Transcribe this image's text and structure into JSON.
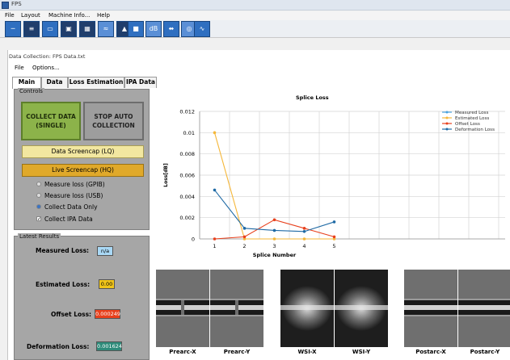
{
  "app": {
    "title": "FPS"
  },
  "menubar": [
    "File",
    "Layout",
    "Machine Info...",
    "Help"
  ],
  "toolbar": {
    "buttons": [
      {
        "icon": "splice-icon",
        "glyph": "─"
      },
      {
        "icon": "fiber-prep-icon",
        "glyph": "≡"
      },
      {
        "icon": "cleave-icon",
        "glyph": "▭"
      },
      {
        "icon": "camera-icon",
        "glyph": "▣"
      },
      {
        "icon": "image-icon",
        "glyph": "▦"
      },
      {
        "icon": "arc-icon",
        "glyph": "≈"
      },
      {
        "icon": "profile-icon",
        "glyph": "▲"
      },
      {
        "icon": "monitor-icon",
        "glyph": "■"
      },
      {
        "icon": "db-icon",
        "glyph": "dB"
      },
      {
        "icon": "network-icon",
        "glyph": "⬌"
      },
      {
        "icon": "focus-icon",
        "glyph": "◎"
      },
      {
        "icon": "signal-icon",
        "glyph": "∿"
      }
    ]
  },
  "document": {
    "title": "Data Collection: FPS Data.txt",
    "menu": [
      "File",
      "Options..."
    ],
    "tabs": [
      "Main",
      "Data",
      "Loss Estimation",
      "IPA Data"
    ],
    "active_tab": "Main"
  },
  "controls": {
    "group_label": "Controls",
    "collect_button": "COLLECT DATA (SINGLE)",
    "stop_button": "STOP AUTO COLLECTION",
    "screencap_lq": "Data Screencap (LQ)",
    "screencap_hq": "Live Screencap (HQ)",
    "options": [
      {
        "label": "Measure loss (GPIB)",
        "type": "radio",
        "checked": false
      },
      {
        "label": "Measure loss (USB)",
        "type": "radio",
        "checked": false
      },
      {
        "label": "Collect Data Only",
        "type": "radio",
        "checked": true
      },
      {
        "label": "Collect IPA Data",
        "type": "checkbox",
        "checked": true
      }
    ]
  },
  "results": {
    "group_label": "Latest Results",
    "measured_label": "Measured Loss:",
    "measured_value": "n/a",
    "estimated_label": "Estimated Loss:",
    "estimated_value": "0.00",
    "offset_label": "Offset Loss:",
    "offset_value": "0.000249",
    "deformation_label": "Deformation Loss:",
    "deformation_value": "0.001624",
    "colors": {
      "measured": "#6bb7e8",
      "estimated": "#e5a800",
      "offset": "#e8401c",
      "deformation": "#2e8b7a"
    }
  },
  "chart_data": {
    "type": "line",
    "title": "Splice Loss",
    "xlabel": "Splice Number",
    "ylabel": "Loss[dB]",
    "x": [
      1,
      2,
      3,
      4,
      5
    ],
    "ylim": [
      0,
      0.012
    ],
    "yticks": [
      "0",
      "0.002",
      "0.004",
      "0.006",
      "0.008",
      "0.01",
      "0.012"
    ],
    "grid": true,
    "legend_position": "top-right",
    "series": [
      {
        "name": "Measured Loss",
        "color": "#4aa3df",
        "values": [
          null,
          null,
          null,
          null,
          null
        ]
      },
      {
        "name": "Estimated Loss",
        "color": "#f5b73a",
        "values": [
          0.01,
          0.0,
          0.0,
          0.0,
          0.0
        ]
      },
      {
        "name": "Offset Loss",
        "color": "#e8401c",
        "values": [
          0.0,
          0.0002,
          0.0018,
          0.001,
          0.0002
        ]
      },
      {
        "name": "Deformation Loss",
        "color": "#1f6aa5",
        "values": [
          0.0046,
          0.001,
          0.0008,
          0.0007,
          0.0016
        ]
      }
    ]
  },
  "images": [
    {
      "label": "Prearc-X",
      "kind": "split"
    },
    {
      "label": "Prearc-Y",
      "kind": "split"
    },
    {
      "label": "WSI-X",
      "kind": "glow"
    },
    {
      "label": "WSI-Y",
      "kind": "glow"
    },
    {
      "label": "Postarc-X",
      "kind": "fiber"
    },
    {
      "label": "Postarc-Y",
      "kind": "fiber"
    }
  ]
}
